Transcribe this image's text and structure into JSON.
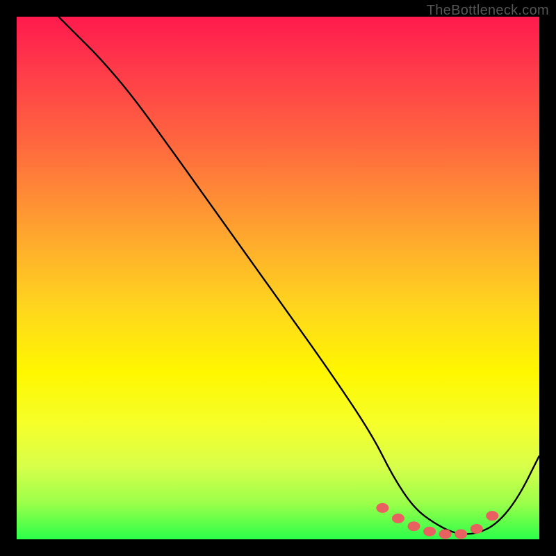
{
  "watermark": "TheBottleneck.com",
  "colors": {
    "background": "#000000",
    "curve": "#000000",
    "sweet_spot_dot": "#e86060"
  },
  "chart_data": {
    "type": "line",
    "title": "",
    "xlabel": "",
    "ylabel": "",
    "xlim": [
      0,
      100
    ],
    "ylim": [
      0,
      100
    ],
    "grid": false,
    "legend": false,
    "series": [
      {
        "name": "bottleneck-curve",
        "x": [
          8,
          12,
          16,
          22,
          30,
          40,
          50,
          60,
          68,
          72,
          76,
          80,
          84,
          88,
          92,
          96,
          100
        ],
        "y": [
          100,
          96,
          92,
          85,
          74,
          60,
          46,
          32,
          20,
          12,
          6,
          3,
          1,
          1,
          3,
          8,
          16
        ]
      }
    ],
    "highlight": {
      "name": "sweet-spot",
      "x": [
        70,
        73,
        76,
        79,
        82,
        85,
        88,
        91
      ],
      "y": [
        6,
        4,
        2.5,
        1.5,
        1,
        1,
        2,
        4.5
      ]
    }
  }
}
